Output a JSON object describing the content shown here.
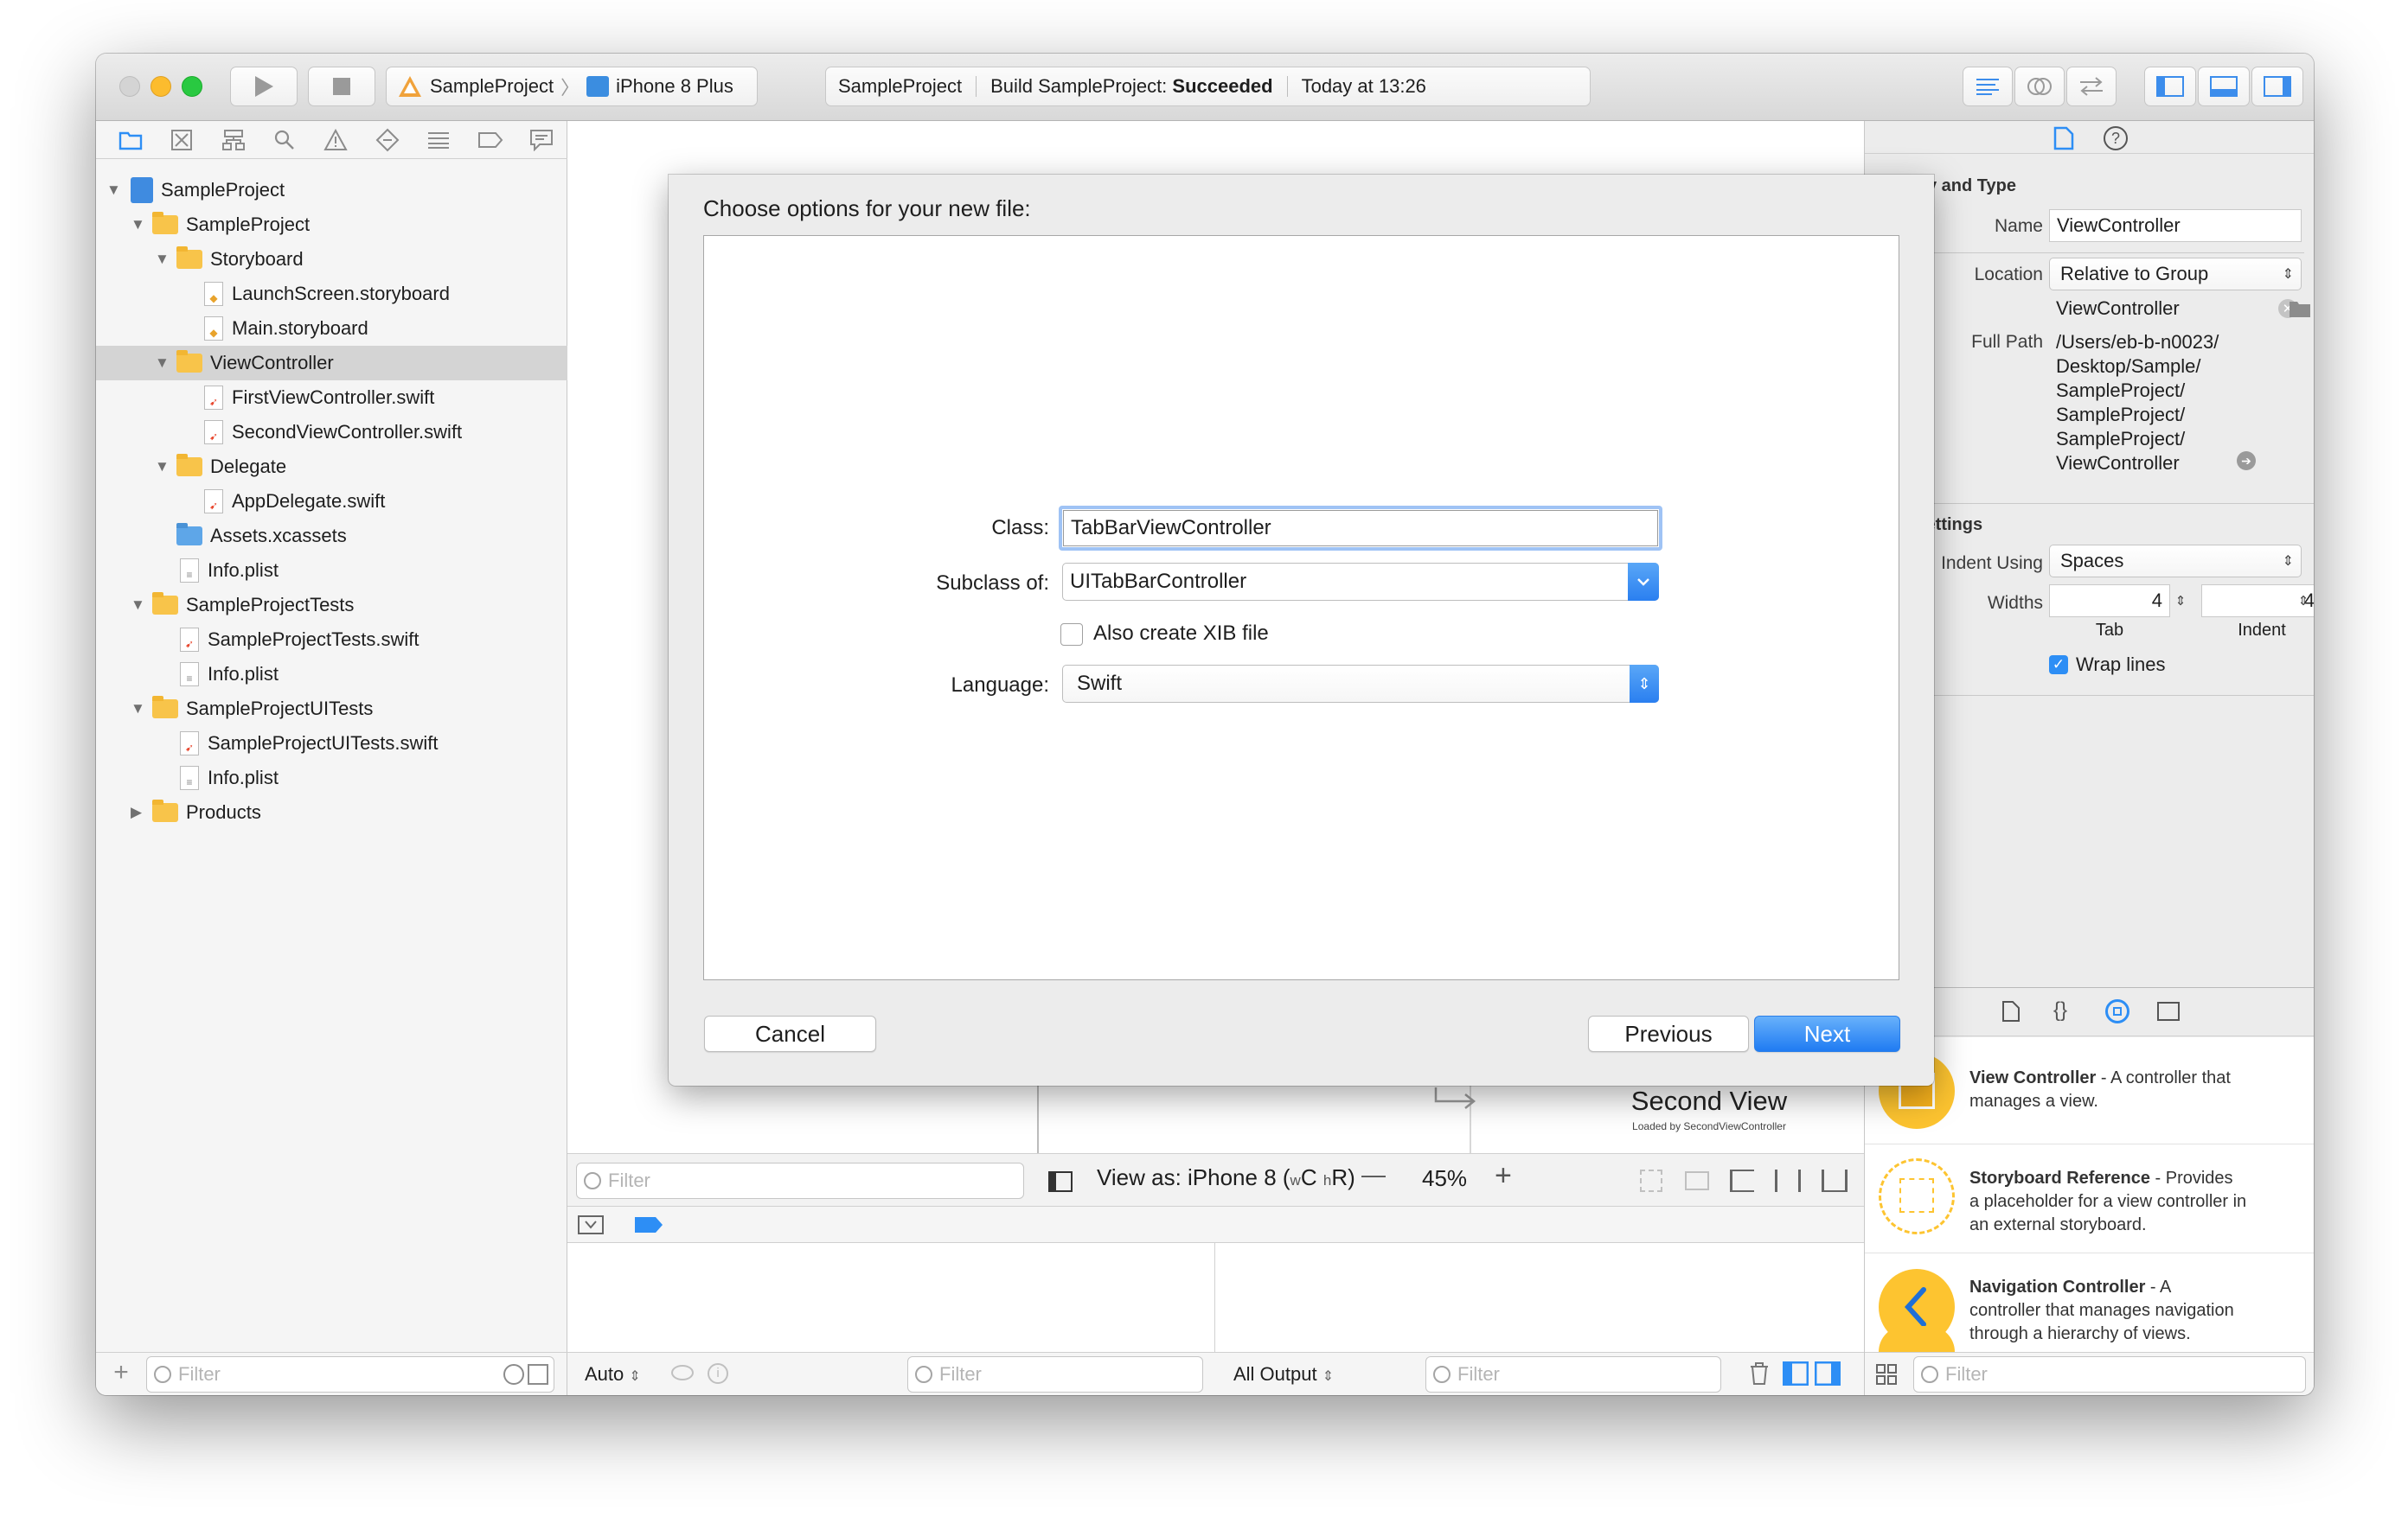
{
  "toolbar": {
    "scheme": "SampleProject",
    "device": "iPhone 8 Plus",
    "activity_project": "SampleProject",
    "activity_prefix": "Build SampleProject: ",
    "activity_status": "Succeeded",
    "activity_time": "Today at 13:26"
  },
  "navigator": {
    "items": [
      {
        "label": "SampleProject"
      },
      {
        "label": "SampleProject"
      },
      {
        "label": "Storyboard"
      },
      {
        "label": "LaunchScreen.storyboard"
      },
      {
        "label": "Main.storyboard"
      },
      {
        "label": "ViewController"
      },
      {
        "label": "FirstViewController.swift"
      },
      {
        "label": "SecondViewController.swift"
      },
      {
        "label": "Delegate"
      },
      {
        "label": "AppDelegate.swift"
      },
      {
        "label": "Assets.xcassets"
      },
      {
        "label": "Info.plist"
      },
      {
        "label": "SampleProjectTests"
      },
      {
        "label": "SampleProjectTests.swift"
      },
      {
        "label": "Info.plist"
      },
      {
        "label": "SampleProjectUITests"
      },
      {
        "label": "SampleProjectUITests.swift"
      },
      {
        "label": "Info.plist"
      },
      {
        "label": "Products"
      }
    ],
    "filter_placeholder": "Filter"
  },
  "dialog": {
    "title": "Choose options for your new file:",
    "class_label": "Class:",
    "class_value": "TabBarViewController",
    "subclass_label": "Subclass of:",
    "subclass_value": "UITabBarController",
    "xib_label": "Also create XIB file",
    "xib_checked": false,
    "language_label": "Language:",
    "language_value": "Swift",
    "cancel": "Cancel",
    "previous": "Previous",
    "next": "Next"
  },
  "canvas": {
    "second_view_title": "Second View",
    "second_view_subtitle": "Loaded by SecondViewController",
    "view_as_prefix": "View as: iPhone 8 (",
    "size_w": "w",
    "size_c": "C",
    "size_h": "h",
    "size_r": "R",
    "view_as_suffix": ")",
    "zoom": "45%",
    "minus": "—",
    "plus": "+",
    "filter_placeholder": "Filter"
  },
  "debug": {
    "auto": "Auto",
    "all_output": "All Output",
    "filter_placeholder": "Filter"
  },
  "inspector": {
    "identity_header": "Identity and Type",
    "name_label": "Name",
    "name_value": "ViewController",
    "location_label": "Location",
    "location_value": "Relative to Group",
    "location_name": "ViewController",
    "full_path_label": "Full Path",
    "full_path": [
      "/Users/eb-b-n0023/",
      "Desktop/Sample/",
      "SampleProject/",
      "SampleProject/",
      "SampleProject/",
      "ViewController"
    ],
    "text_settings_header": "Text Settings",
    "indent_using_label": "Indent Using",
    "indent_using_value": "Spaces",
    "widths_label": "Widths",
    "tab_value": "4",
    "indent_value": "4",
    "tab_label": "Tab",
    "indent_label": "Indent",
    "wrap_label": "Wrap lines",
    "wrap_checked": true
  },
  "library": {
    "items": [
      {
        "title": "View Controller",
        "desc1": " - A controller that",
        "desc2": "manages a view.",
        "desc3": ""
      },
      {
        "title": "Storyboard Reference",
        "desc1": " - Provides",
        "desc2": "a placeholder for a view controller in",
        "desc3": "an external storyboard."
      },
      {
        "title": "Navigation Controller",
        "desc1": " - A",
        "desc2": "controller that manages navigation",
        "desc3": "through a hierarchy of views."
      }
    ],
    "filter_placeholder": "Filter"
  },
  "colors": {
    "accent": "#2d8ef5",
    "folder": "#f8c44a",
    "library_icon": "#fdc430"
  }
}
